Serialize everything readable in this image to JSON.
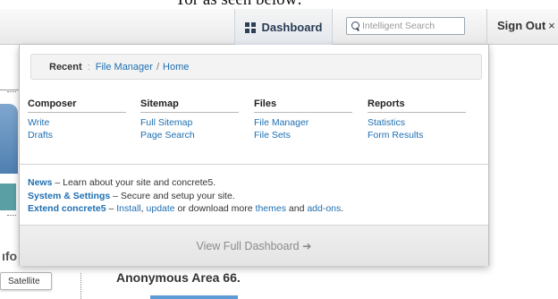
{
  "caption": {
    "text": "Tor as seen below:"
  },
  "toolbar": {
    "dashboard_label": "Dashboard",
    "search_placeholder": "Intelligent Search",
    "signout_label": "Sign Out",
    "signout_glyph": "×"
  },
  "background": {
    "fragment_text": "ıfo",
    "satellite_label": "Satellite",
    "area_title": "Anonymous Area 66."
  },
  "panel": {
    "breadcrumb": {
      "recent_label": "Recent",
      "separator": ":",
      "items": [
        "File Manager",
        "Home"
      ],
      "slash": "/"
    },
    "columns": [
      {
        "title": "Composer",
        "links": [
          "Write",
          "Drafts"
        ]
      },
      {
        "title": "Sitemap",
        "links": [
          "Full Sitemap",
          "Page Search"
        ]
      },
      {
        "title": "Files",
        "links": [
          "File Manager",
          "File Sets"
        ]
      },
      {
        "title": "Reports",
        "links": [
          "Statistics",
          "Form Results"
        ]
      }
    ],
    "info": {
      "news_label": "News",
      "news_text": " – Learn about your site and concrete5.",
      "system_label": "System & Settings",
      "system_text": " – Secure and setup your site.",
      "extend_label": "Extend concrete5",
      "extend_text_1": " – ",
      "install_link": "Install",
      "comma": ", ",
      "update_link": "update",
      "extend_text_2": " or download more ",
      "themes_link": "themes",
      "and_text": " and ",
      "addons_link": "add-ons",
      "period": "."
    },
    "footer": {
      "view_full_label": "View Full Dashboard ➜"
    }
  }
}
